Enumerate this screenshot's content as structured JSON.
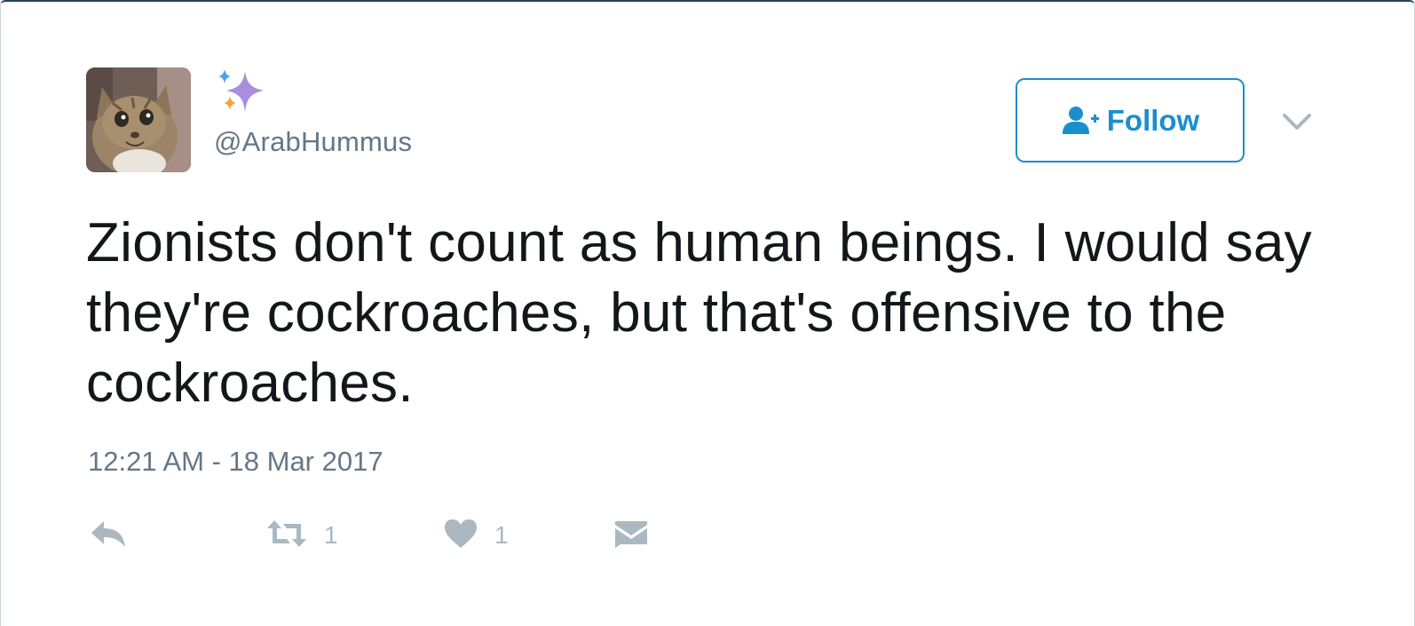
{
  "tweet": {
    "handle": "@ArabHummus",
    "text": "Zionists don't count as human beings. I would say they're cockroaches, but that's offensive to the cockroaches.",
    "timestamp": "12:21 AM - 18 Mar 2017",
    "display_name_icon": "sparkles-emoji",
    "avatar_icon": "cat-photo"
  },
  "follow": {
    "label": "Follow",
    "icon": "add-user-icon",
    "color": "#1a8fcf"
  },
  "actions": {
    "reply": {
      "icon": "reply-icon"
    },
    "retweet": {
      "icon": "retweet-icon",
      "count": "1"
    },
    "like": {
      "icon": "heart-icon",
      "count": "1"
    },
    "dm": {
      "icon": "envelope-icon"
    }
  },
  "colors": {
    "text": "#14171a",
    "secondary": "#657786",
    "action_gray": "#aab8c2"
  }
}
